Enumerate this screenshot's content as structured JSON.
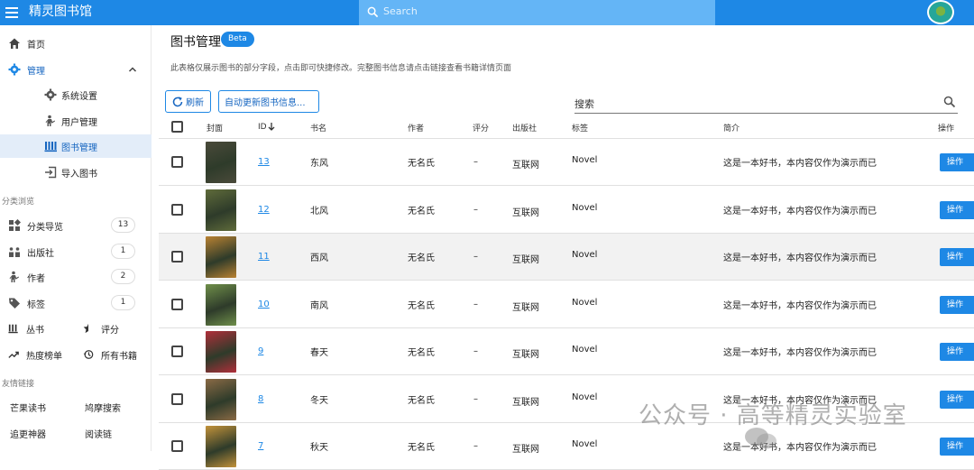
{
  "app": {
    "title": "精灵图书馆",
    "search_placeholder": "Search"
  },
  "colors": {
    "primary": "#1e88e5",
    "active_nav": "#e3edf9"
  },
  "sidebar": {
    "nav": [
      {
        "label": "首页",
        "icon": "home-icon"
      },
      {
        "label": "管理",
        "icon": "gear-icon"
      },
      {
        "label": "系统设置",
        "icon": "gear-icon"
      },
      {
        "label": "用户管理",
        "icon": "person-icon"
      },
      {
        "label": "图书管理",
        "icon": "books-icon"
      },
      {
        "label": "导入图书",
        "icon": "import-icon"
      }
    ],
    "browse_title": "分类浏览",
    "browse": [
      {
        "label": "分类导览",
        "count": "13",
        "icon": "category-icon"
      },
      {
        "label": "出版社",
        "count": "1",
        "icon": "publisher-icon"
      },
      {
        "label": "作者",
        "count": "2",
        "icon": "author-icon"
      },
      {
        "label": "标签",
        "count": "1",
        "icon": "tag-icon"
      }
    ],
    "tools": [
      {
        "label": "丛书",
        "icon": "series-icon"
      },
      {
        "label": "评分",
        "icon": "star-half-icon"
      },
      {
        "label": "热度榜单",
        "icon": "trending-icon"
      },
      {
        "label": "所有书籍",
        "icon": "history-icon"
      }
    ],
    "links_title": "友情链接",
    "links": [
      "芒果读书",
      "鸠摩搜索",
      "追更神器",
      "阅读链"
    ]
  },
  "main": {
    "title": "图书管理",
    "beta": "Beta",
    "description": "此表格仅展示图书的部分字段，点击即可快捷修改。完整图书信息请点击链接查看书籍详情页面",
    "refresh_label": "刷新",
    "auto_update_label": "自动更新图书信息...",
    "search_label": "搜索",
    "columns": [
      "封面",
      "ID",
      "书名",
      "作者",
      "评分",
      "出版社",
      "标签",
      "简介",
      "操作"
    ],
    "rows": [
      {
        "id": "13",
        "title": "东风",
        "author": "无名氏",
        "rating": "–",
        "publisher": "互联网",
        "tag": "Novel",
        "summary": "这是一本好书，本内容仅作为演示而已",
        "action": "操作",
        "cover": "#4a4a3a"
      },
      {
        "id": "12",
        "title": "北风",
        "author": "无名氏",
        "rating": "–",
        "publisher": "互联网",
        "tag": "Novel",
        "summary": "这是一本好书，本内容仅作为演示而已",
        "action": "操作",
        "cover": "#5f6b3a"
      },
      {
        "id": "11",
        "title": "西风",
        "author": "无名氏",
        "rating": "–",
        "publisher": "互联网",
        "tag": "Novel",
        "summary": "这是一本好书，本内容仅作为演示而已",
        "action": "操作",
        "cover": "#b98232"
      },
      {
        "id": "10",
        "title": "南风",
        "author": "无名氏",
        "rating": "–",
        "publisher": "互联网",
        "tag": "Novel",
        "summary": "这是一本好书，本内容仅作为演示而已",
        "action": "操作",
        "cover": "#6f8f4a"
      },
      {
        "id": "9",
        "title": "春天",
        "author": "无名氏",
        "rating": "–",
        "publisher": "互联网",
        "tag": "Novel",
        "summary": "这是一本好书，本内容仅作为演示而已",
        "action": "操作",
        "cover": "#b02f3a"
      },
      {
        "id": "8",
        "title": "冬天",
        "author": "无名氏",
        "rating": "–",
        "publisher": "互联网",
        "tag": "Novel",
        "summary": "这是一本好书，本内容仅作为演示而已",
        "action": "操作",
        "cover": "#8a6a45"
      },
      {
        "id": "7",
        "title": "秋天",
        "author": "无名氏",
        "rating": "–",
        "publisher": "互联网",
        "tag": "Novel",
        "summary": "这是一本好书，本内容仅作为演示而已",
        "action": "操作",
        "cover": "#c2923a"
      }
    ]
  },
  "watermark": "公众号 · 高等精灵实验室"
}
